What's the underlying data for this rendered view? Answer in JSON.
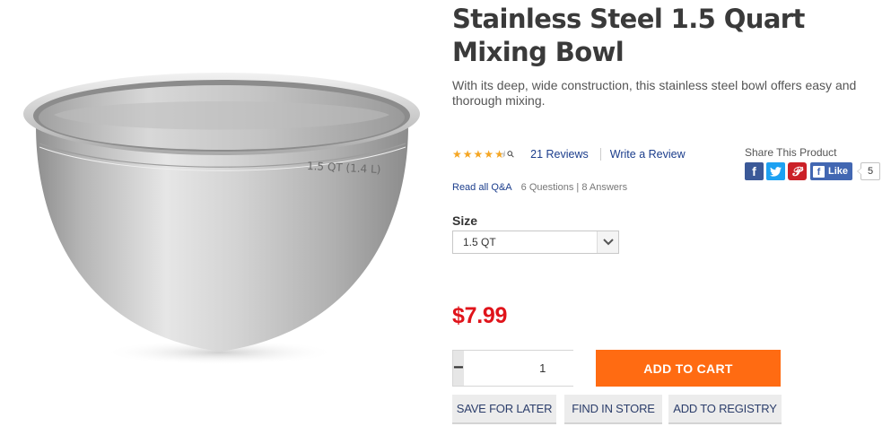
{
  "product": {
    "title": "Stainless Steel 1.5 Quart Mixing Bowl",
    "description": "With its deep, wide construction, this stainless steel bowl offers easy and thorough mixing.",
    "image_label": "1.5 QT (1.4 L)",
    "price": "$7.99"
  },
  "rating": {
    "stars": 4.5,
    "reviews_label": "21 Reviews",
    "write_review_label": "Write a Review"
  },
  "qa": {
    "link_label": "Read all Q&A",
    "meta": "6 Questions | 8 Answers"
  },
  "share": {
    "label": "Share This Product",
    "like_label": "Like",
    "like_count": "5"
  },
  "size": {
    "label": "Size",
    "selected": "1.5 QT"
  },
  "quantity": {
    "value": "1",
    "minus": "−",
    "plus": "+"
  },
  "buttons": {
    "add_to_cart": "ADD TO CART",
    "save_for_later": "SAVE FOR LATER",
    "find_in_store": "FIND IN STORE",
    "add_to_registry": "ADD TO REGISTRY"
  },
  "colors": {
    "price": "#e0141b",
    "cta": "#ff6b12",
    "link": "#1b3d8c",
    "star": "#f5a623"
  }
}
